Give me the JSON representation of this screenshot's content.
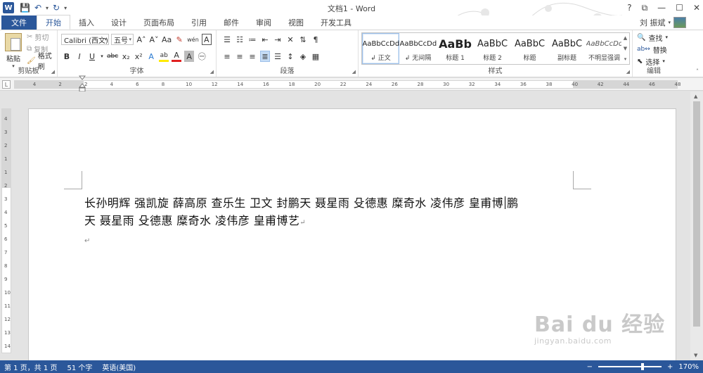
{
  "app": {
    "window_title": "文档1 - Word",
    "logo_letter": "W"
  },
  "window_controls": {
    "help": "?",
    "ribbon_opts": "⧉",
    "minimize": "—",
    "maximize": "☐",
    "close": "✕"
  },
  "user": {
    "name": "刘 振斌"
  },
  "tabs": [
    {
      "label": "文件"
    },
    {
      "label": "开始"
    },
    {
      "label": "插入"
    },
    {
      "label": "设计"
    },
    {
      "label": "页面布局"
    },
    {
      "label": "引用"
    },
    {
      "label": "邮件"
    },
    {
      "label": "审阅"
    },
    {
      "label": "视图"
    },
    {
      "label": "开发工具"
    }
  ],
  "clipboard": {
    "group_label": "剪贴板",
    "paste": "粘贴",
    "cut": "剪切",
    "copy": "复制",
    "format_painter": "格式刷"
  },
  "font": {
    "group_label": "字体",
    "name": "Calibri (西文)",
    "size": "五号",
    "grow": "A˄",
    "shrink": "A˅",
    "case": "Aa",
    "clear": "✎",
    "phonetic": "wén",
    "border_char": "A",
    "bold": "B",
    "italic": "I",
    "underline": "U",
    "strike": "abc",
    "sub": "x₂",
    "sup": "x²",
    "effects": "A",
    "highlight": "ab",
    "color": "A",
    "shade": "A",
    "enclose": "㊀"
  },
  "paragraph": {
    "group_label": "段落"
  },
  "styles": {
    "group_label": "样式",
    "items": [
      {
        "sample": "AaBbCcDd",
        "name": "↲ 正文"
      },
      {
        "sample": "AaBbCcDd",
        "name": "↲ 无间隔"
      },
      {
        "sample": "AaBb",
        "name": "标题 1"
      },
      {
        "sample": "AaBbC",
        "name": "标题 2"
      },
      {
        "sample": "AaBbC",
        "name": "标题"
      },
      {
        "sample": "AaBbC",
        "name": "副标题"
      },
      {
        "sample": "AaBbCcDd",
        "name": "不明显强调"
      }
    ]
  },
  "editing": {
    "group_label": "编辑",
    "find": "查找",
    "replace": "替换",
    "select": "选择"
  },
  "ruler": {
    "ticks": [
      "4",
      "2",
      "2",
      "4",
      "6",
      "8",
      "10",
      "12",
      "14",
      "16",
      "18",
      "20",
      "22",
      "24",
      "26",
      "28",
      "30",
      "32",
      "34",
      "36",
      "38",
      "40",
      "42",
      "44",
      "46",
      "48"
    ],
    "vticks": [
      "4",
      "3",
      "2",
      "1",
      "1",
      "2",
      "3",
      "4",
      "5",
      "6",
      "7",
      "8",
      "9",
      "10",
      "11",
      "12",
      "13",
      "14"
    ]
  },
  "document": {
    "line1_a": "长孙明辉 强凯旋 薛高原 查乐生 卫文 封鹏天 聂星雨 殳德惠 糜奇水 凌伟彦 皇甫博",
    "line1_b": "鹏",
    "line2": "天 聂星雨 殳德惠 糜奇水 凌伟彦 皇甫博艺",
    "para_mark": "↵"
  },
  "status": {
    "page": "第 1 页，共 1 页",
    "words": "51 个字",
    "lang": "英语(美国)",
    "zoom": "170%"
  },
  "watermark": {
    "brand": "Bai du 经验",
    "url": "jingyan.baidu.com"
  }
}
